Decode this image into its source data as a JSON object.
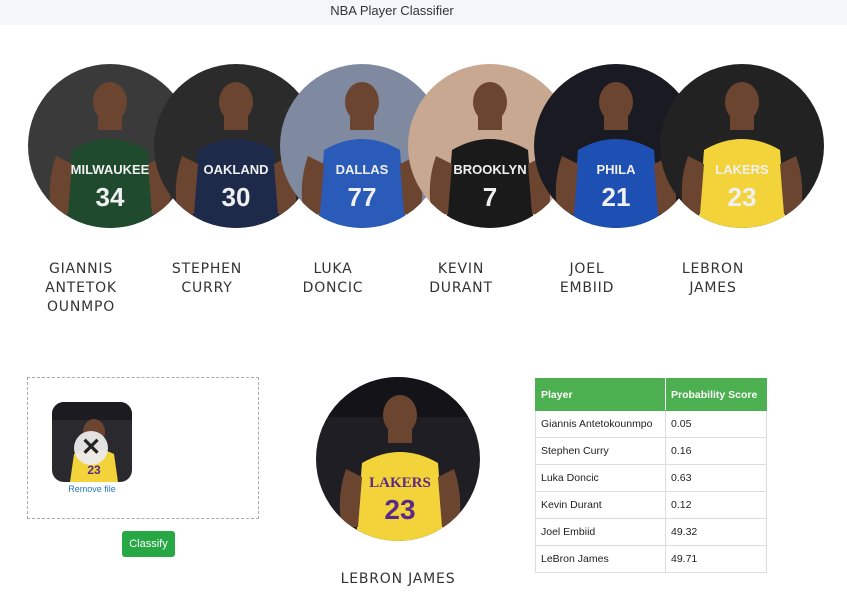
{
  "app": {
    "title": "NBA Player Classifier"
  },
  "players": [
    {
      "name": "GIANNIS ANTETOK OUNMPO",
      "jersey_label": "MILWAUKEE",
      "number": "34",
      "jersey_color": "#1f4a2e",
      "bg_color": "#3a3a3a"
    },
    {
      "name": "STEPHEN CURRY",
      "jersey_label": "OAKLAND",
      "number": "30",
      "jersey_color": "#1d2a4a",
      "bg_color": "#2b2b2b"
    },
    {
      "name": "LUKA DONCIC",
      "jersey_label": "DALLAS",
      "number": "77",
      "jersey_color": "#2a5bb8",
      "bg_color": "#7f8aa0"
    },
    {
      "name": "KEVIN DURANT",
      "jersey_label": "BROOKLYN",
      "number": "7",
      "jersey_color": "#1a1a1a",
      "bg_color": "#c8a890"
    },
    {
      "name": "JOEL EMBIID",
      "jersey_label": "PHILA",
      "number": "21",
      "jersey_color": "#1e4fb3",
      "bg_color": "#1a1a22"
    },
    {
      "name": "LEBRON JAMES",
      "jersey_label": "LAKERS",
      "number": "23",
      "jersey_color": "#f2d33a",
      "bg_color": "#222"
    }
  ],
  "upload": {
    "remove_label": "Remove file",
    "remove_icon": "close-icon",
    "classify_label": "Classify"
  },
  "result": {
    "name": "LEBRON JAMES",
    "jersey_label": "LAKERS",
    "number": "23"
  },
  "table": {
    "headers": [
      "Player",
      "Probability Score"
    ],
    "rows": [
      [
        "Giannis Antetokounmpo",
        "0.05"
      ],
      [
        "Stephen Curry",
        "0.16"
      ],
      [
        "Luka Doncic",
        "0.63"
      ],
      [
        "Kevin Durant",
        "0.12"
      ],
      [
        "Joel Embiid",
        "49.32"
      ],
      [
        "LeBron James",
        "49.71"
      ]
    ]
  },
  "colors": {
    "accent_green": "#4caf50",
    "button_green": "#28a745",
    "link_blue": "#2a7ab8",
    "topbar": "#f5f6f7"
  }
}
